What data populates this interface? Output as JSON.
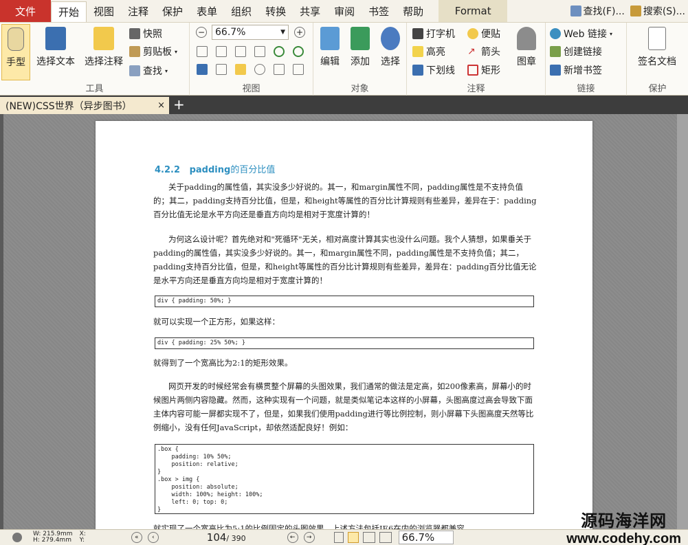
{
  "menubar": {
    "file": "文件",
    "tabs": [
      "开始",
      "视图",
      "注释",
      "保护",
      "表单",
      "组织",
      "转换",
      "共享",
      "审阅",
      "书签",
      "帮助"
    ],
    "active_tab": "开始",
    "format": "Format",
    "find": "查找(F)...",
    "search": "搜索(S)..."
  },
  "ribbon": {
    "tools": {
      "label": "工具",
      "hand": "手型",
      "select_text": "选择文本",
      "select_annot": "选择注释",
      "snapshot": "快照",
      "clipboard": "剪贴板",
      "find": "查找"
    },
    "view": {
      "label": "视图",
      "zoom": "66.7%"
    },
    "object": {
      "label": "对象",
      "edit": "编辑",
      "add": "添加",
      "select": "选择"
    },
    "annot": {
      "label": "注释",
      "typewriter": "打字机",
      "highlight": "高亮",
      "underline": "下划线",
      "note": "便贴",
      "arrow": "箭头",
      "rect": "矩形",
      "stamp": "图章"
    },
    "links": {
      "label": "链接",
      "web": "Web 链接",
      "create": "创建链接",
      "bookmark": "新增书签"
    },
    "protect": {
      "label": "保护",
      "sign": "签名文档"
    }
  },
  "tab": {
    "title": "(NEW)CSS世界（异步图书）",
    "close": "×",
    "new": "+"
  },
  "doc": {
    "heading_num": "4.2.2",
    "heading_code": "padding",
    "heading_text": "的百分比值",
    "p1": "关于padding的属性值，其实没多少好说的。其一，和margin属性不同，padding属性是不支持负值的；其二，padding支持百分比值，但是，和height等属性的百分比计算规则有些差异，差异在于：padding百分比值无论是水平方向还是垂直方向均是相对于宽度计算的！",
    "p2": "为何这么设计呢？首先绝对和\"死循环\"无关，相对高度计算其实也没什么问题。我个人猜想，如果垂关于padding的属性值，其实没多少好说的。其一，和margin属性不同，padding属性是不支持负值；其二，padding支持百分比值，但是，和height等属性的百分比计算规则有些差异，差异在：padding百分比值无论是水平方向还是垂直方向均是相对于宽度计算的！",
    "code1": "div { padding: 50%; }",
    "cap1": "就可以实现一个正方形，如果这样：",
    "code2": "div { padding: 25% 50%; }",
    "cap2": "就得到了一个宽高比为2:1的矩形效果。",
    "p3": "网页开发的时候经常会有横贯整个屏幕的头图效果，我们通常的做法是定高，如200像素高，屏幕小的时候图片两侧内容隐藏。然而，这种实现有一个问题，就是类似笔记本这样的小屏幕，头图高度过高会导致下面主体内容可能一屏都实现不了，但是，如果我们使用padding进行等比例控制，则小屏幕下头图高度天然等比例缩小，没有任何JavaScript，却依然适配良好！例如：",
    "code3": ".box {\n    padding: 10% 50%;\n    position: relative;\n}\n.box > img {\n    position: absolute;\n    width: 100%; height: 100%;\n    left: 0; top: 0;\n}",
    "last_line": "就实现了一个宽高比为5:1的比例固定的头图效果，上述方法包括IE6在内的浏览器都兼容"
  },
  "status": {
    "w": "W: 215.9mm",
    "h": "H: 279.4mm",
    "x": "X:",
    "y": "Y:",
    "page_current": "104",
    "page_total": "/ 390",
    "zoom": "66.7%"
  },
  "watermark": {
    "line1": "源码海洋网",
    "line2": "www.codehy.com"
  },
  "colors": {
    "file_red": "#c9332c",
    "heading_blue": "#2d8fc0",
    "active_hand": "#fde9a8"
  }
}
